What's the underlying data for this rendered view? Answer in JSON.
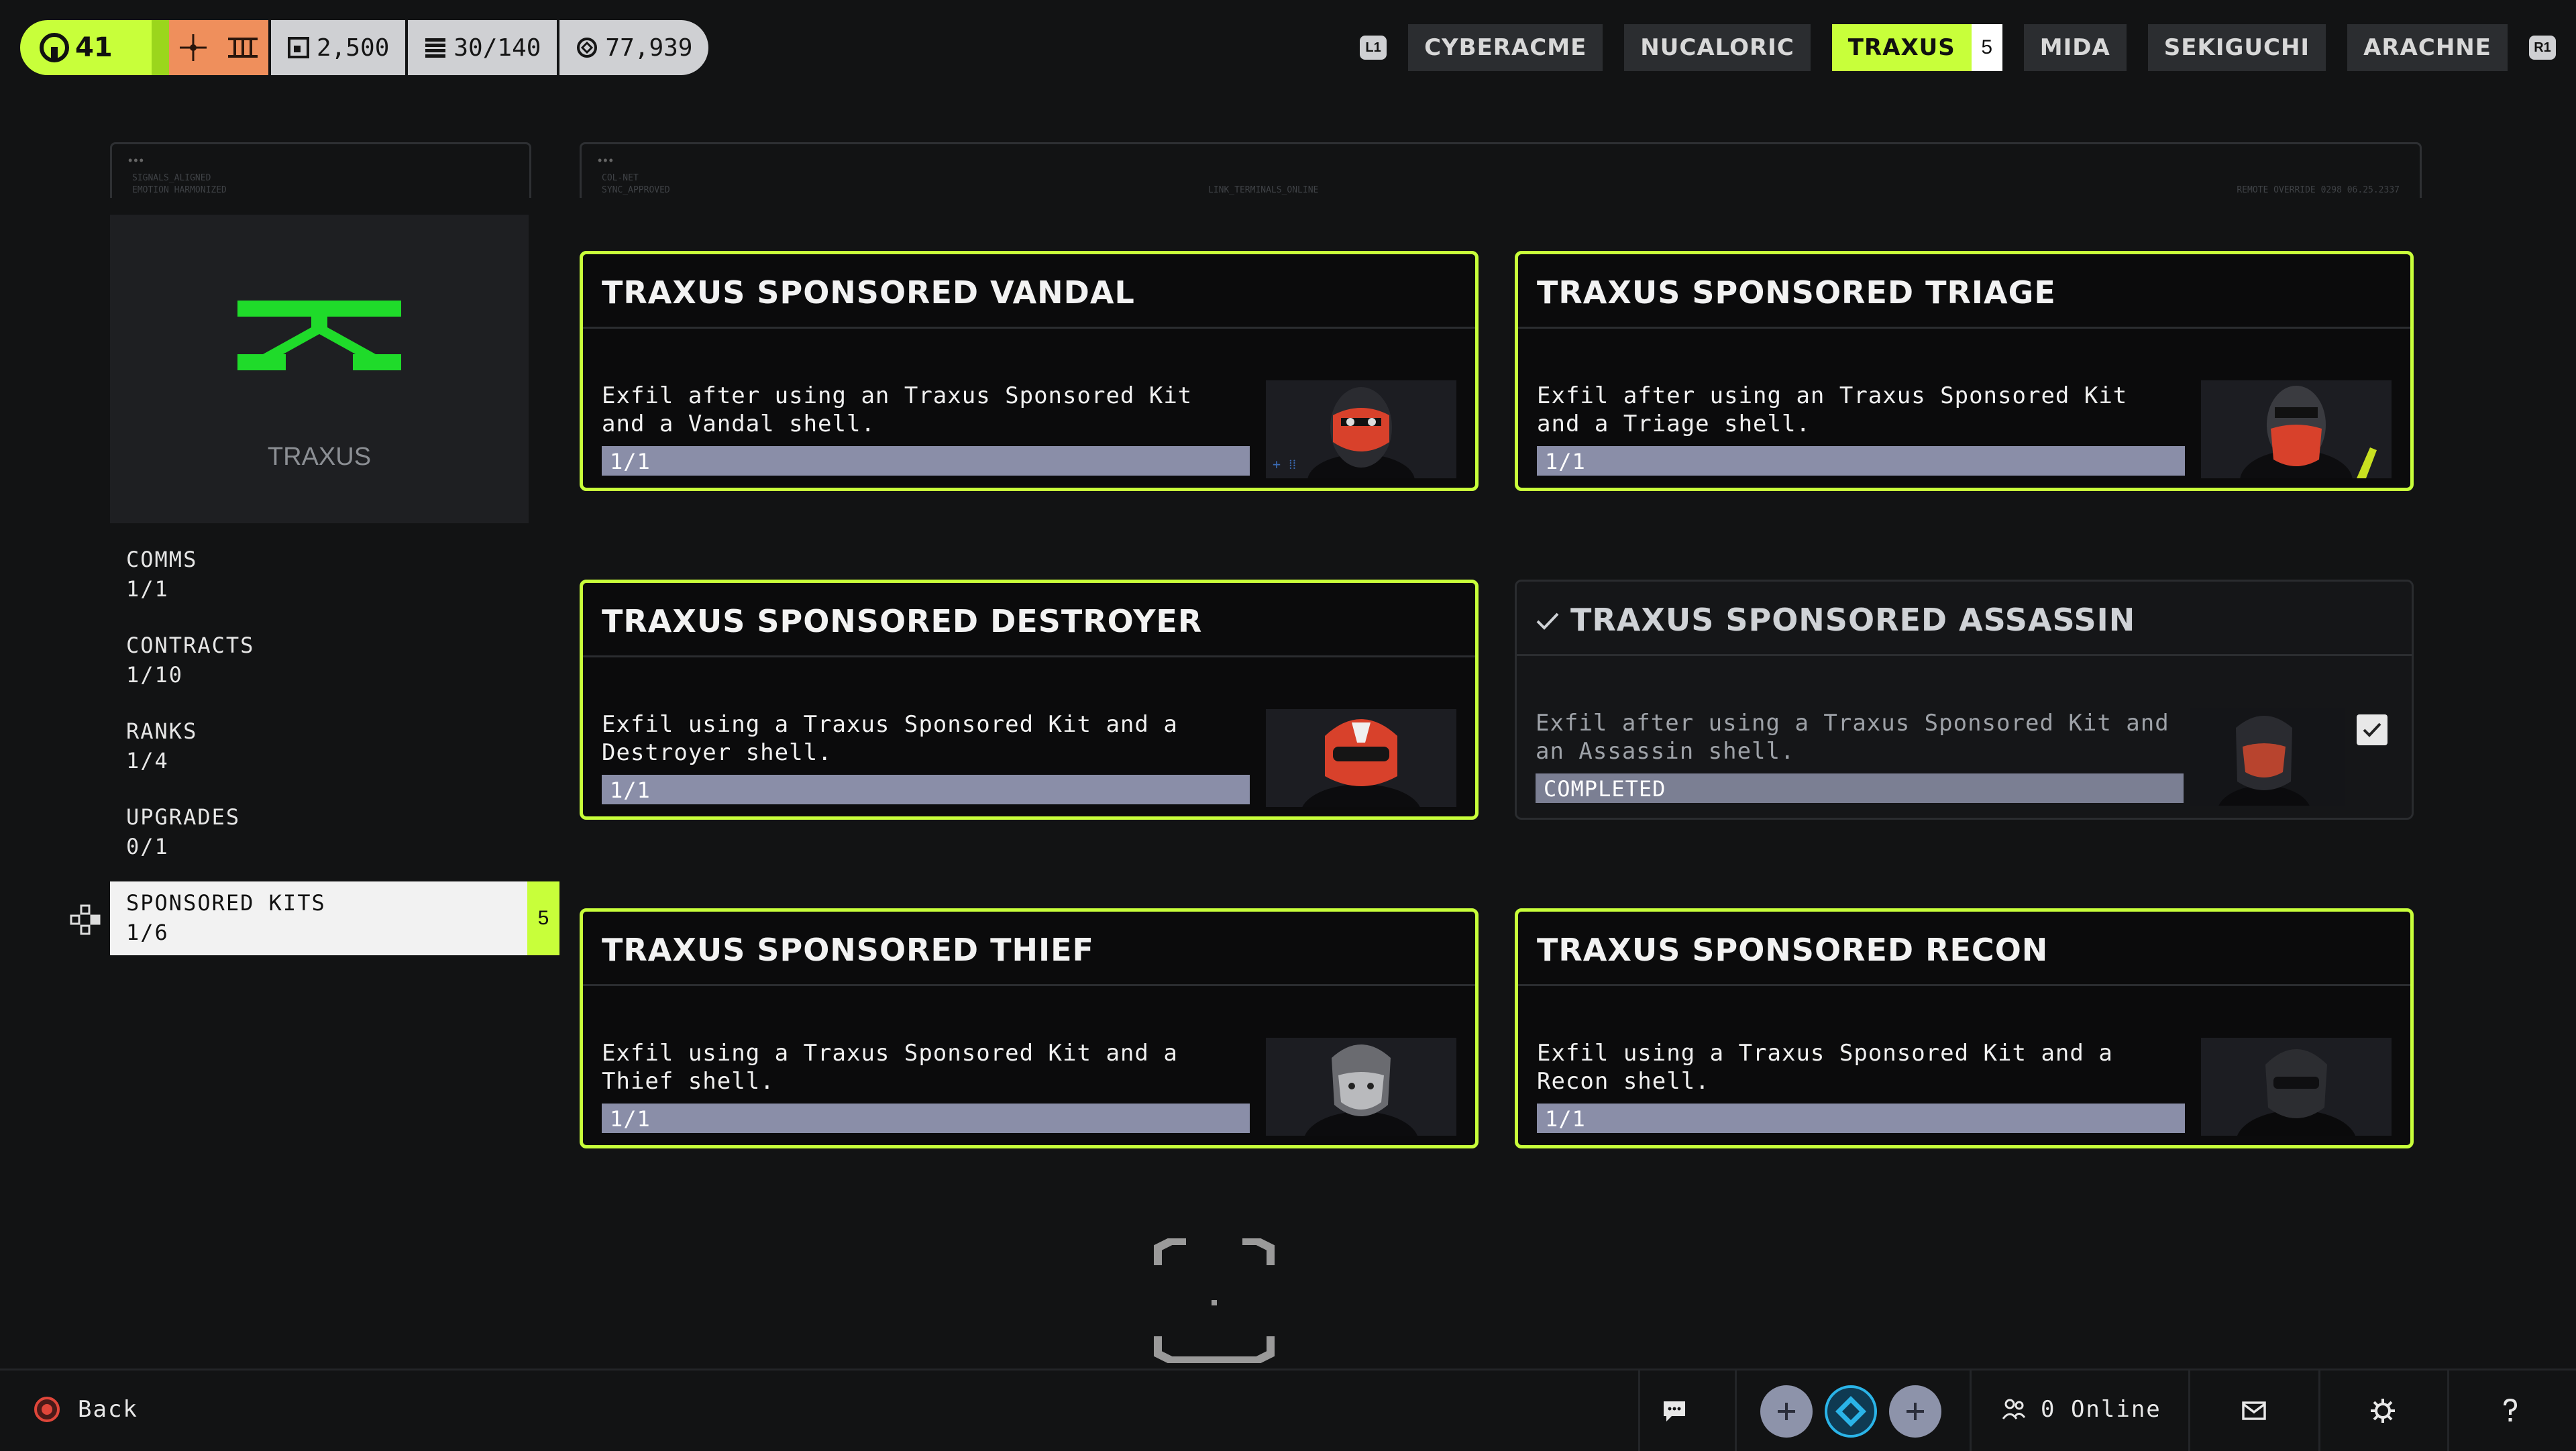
{
  "topbar": {
    "level": "41",
    "stats": [
      {
        "icon": "square-icon",
        "value": "2,500"
      },
      {
        "icon": "stack-icon",
        "value": "30/140"
      },
      {
        "icon": "coin-icon",
        "value": "77,939"
      }
    ]
  },
  "factions": {
    "left_key": "L1",
    "right_key": "R1",
    "tabs": [
      {
        "label": "CYBERACME"
      },
      {
        "label": "NUCALORIC"
      },
      {
        "label": "TRAXUS",
        "count": "5"
      },
      {
        "label": "MIDA"
      },
      {
        "label": "SEKIGUCHI"
      },
      {
        "label": "ARACHNE"
      }
    ]
  },
  "header_frames": {
    "left": [
      "SIGNALS_ALIGNED",
      "EMOTION HARMONIZED"
    ],
    "right": [
      "COL-NET",
      "SYNC_APPROVED"
    ],
    "center": "LINK_TERMINALS_ONLINE",
    "corner": "REMOTE OVERRIDE 0298 06.25.2337"
  },
  "faction_panel": {
    "name": "TRAXUS",
    "logo_color": "#1fdb2a"
  },
  "nav": [
    {
      "label": "COMMS",
      "progress": "1/1"
    },
    {
      "label": "CONTRACTS",
      "progress": "1/10"
    },
    {
      "label": "RANKS",
      "progress": "1/4"
    },
    {
      "label": "UPGRADES",
      "progress": "0/1"
    },
    {
      "label": "SPONSORED KITS",
      "progress": "1/6",
      "badge": "5"
    }
  ],
  "cards": [
    {
      "title": "TRAXUS SPONSORED VANDAL",
      "desc": "Exfil after using an Traxus Sponsored Kit\nand a Vandal shell.",
      "status": "1/1"
    },
    {
      "title": "TRAXUS SPONSORED TRIAGE",
      "desc": "Exfil after using an Traxus Sponsored Kit\nand a Triage shell.",
      "status": "1/1"
    },
    {
      "title": "TRAXUS SPONSORED DESTROYER",
      "desc": "Exfil using a Traxus Sponsored Kit and a\nDestroyer shell.",
      "status": "1/1"
    },
    {
      "title": "TRAXUS SPONSORED ASSASSIN",
      "desc": "Exfil after using a Traxus Sponsored Kit and\nan Assassin shell.",
      "status": "COMPLETED"
    },
    {
      "title": "TRAXUS SPONSORED THIEF",
      "desc": "Exfil using a Traxus Sponsored Kit and a\nThief shell.",
      "status": "1/1"
    },
    {
      "title": "TRAXUS SPONSORED RECON",
      "desc": "Exfil using a Traxus Sponsored Kit and a\nRecon shell.",
      "status": "1/1"
    }
  ],
  "bottombar": {
    "back_label": "Back",
    "online_label": "0 Online"
  },
  "colors": {
    "accent": "#c8ff3a",
    "orange": "#ef8f5c",
    "progress_bar": "#8a8ea8"
  }
}
